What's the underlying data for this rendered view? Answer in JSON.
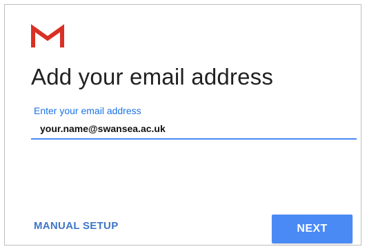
{
  "dialog": {
    "logo_icon": "gmail-m-icon",
    "title": "Add your email address",
    "email_field": {
      "label": "Enter your email address",
      "value": "your.name@swansea.ac.uk"
    },
    "manual_setup_label": "MANUAL SETUP",
    "next_label": "NEXT"
  },
  "colors": {
    "accent_blue": "#4a8af4",
    "label_blue": "#1a73e8",
    "link_blue": "#3f74c6",
    "gmail_red": "#d93025",
    "title_text": "#212121"
  }
}
